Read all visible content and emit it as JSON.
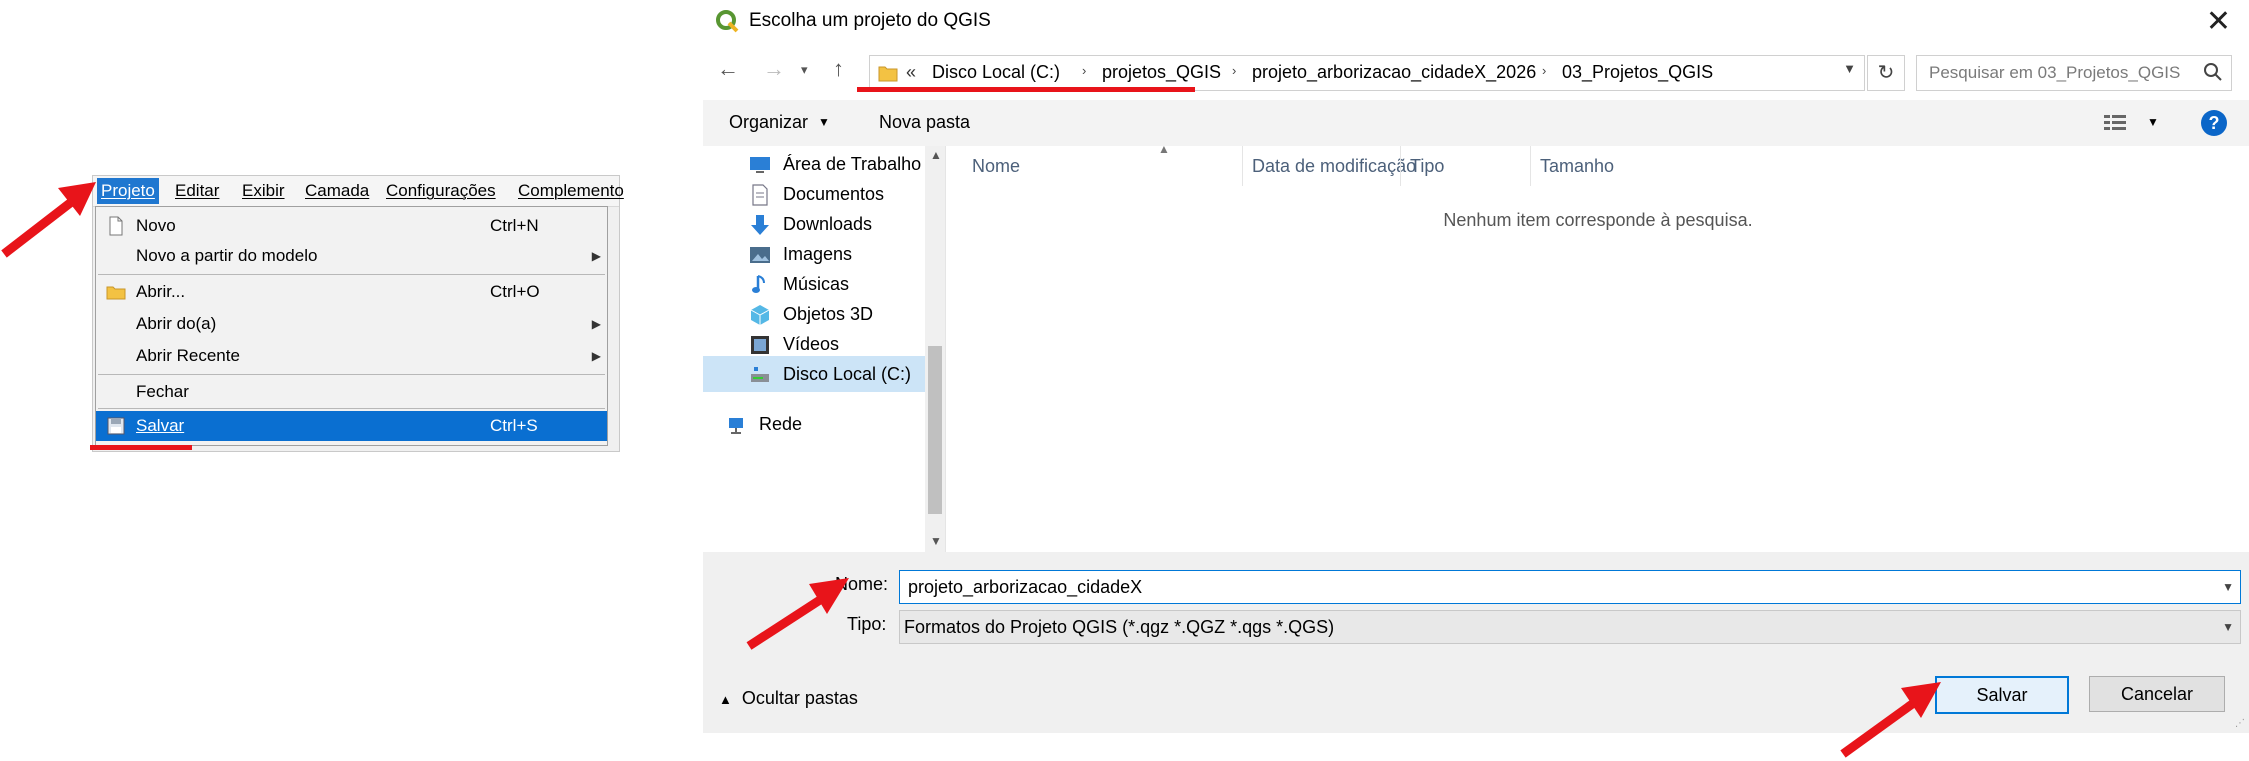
{
  "left_panel": {
    "menubar": [
      "Projeto",
      "Editar",
      "Exibir",
      "Camada",
      "Configurações",
      "Complemento"
    ],
    "menu_items": [
      {
        "label": "Novo",
        "shortcut": "Ctrl+N",
        "icon": "new-document-icon"
      },
      {
        "label": "Novo a partir do modelo",
        "shortcut": "",
        "submenu": true
      },
      {
        "label": "Abrir...",
        "shortcut": "Ctrl+O",
        "icon": "folder-icon"
      },
      {
        "label": "Abrir do(a)",
        "shortcut": "",
        "submenu": true
      },
      {
        "label": "Abrir Recente",
        "shortcut": "",
        "submenu": true
      },
      {
        "label": "Fechar",
        "shortcut": ""
      },
      {
        "label": "Salvar",
        "shortcut": "Ctrl+S",
        "icon": "save-icon",
        "selected": true
      }
    ]
  },
  "dialog": {
    "title": "Escolha um projeto do QGIS",
    "breadcrumbs": [
      "«",
      "Disco Local (C:)",
      "projetos_QGIS",
      "projeto_arborizacao_cidadeX_2026",
      "03_Projetos_QGIS"
    ],
    "search_placeholder": "Pesquisar em 03_Projetos_QGIS",
    "toolbar": {
      "organize": "Organizar",
      "new_folder": "Nova pasta"
    },
    "nav_items": [
      {
        "label": "Área de Trabalho",
        "icon": "desktop-icon"
      },
      {
        "label": "Documentos",
        "icon": "documents-icon"
      },
      {
        "label": "Downloads",
        "icon": "downloads-icon"
      },
      {
        "label": "Imagens",
        "icon": "images-icon"
      },
      {
        "label": "Músicas",
        "icon": "music-icon"
      },
      {
        "label": "Objetos 3D",
        "icon": "3d-objects-icon"
      },
      {
        "label": "Vídeos",
        "icon": "videos-icon"
      },
      {
        "label": "Disco Local (C:)",
        "icon": "drive-icon",
        "selected": true
      },
      {
        "label": "Rede",
        "icon": "network-icon"
      }
    ],
    "columns": [
      "Nome",
      "Data de modificação",
      "Tipo",
      "Tamanho"
    ],
    "empty_message": "Nenhum item corresponde à pesquisa.",
    "name_label": "Nome:",
    "name_value": "projeto_arborizacao_cidadeX",
    "type_label": "Tipo:",
    "type_value": "Formatos do Projeto QGIS (*.qgz *.QGZ *.qgs *.QGS)",
    "hide_folders": "Ocultar pastas",
    "save": "Salvar",
    "cancel": "Cancelar"
  },
  "colors": {
    "accent": "#0078d7",
    "annotation": "#e8141a",
    "menu_selected": "#0a6fd1"
  }
}
